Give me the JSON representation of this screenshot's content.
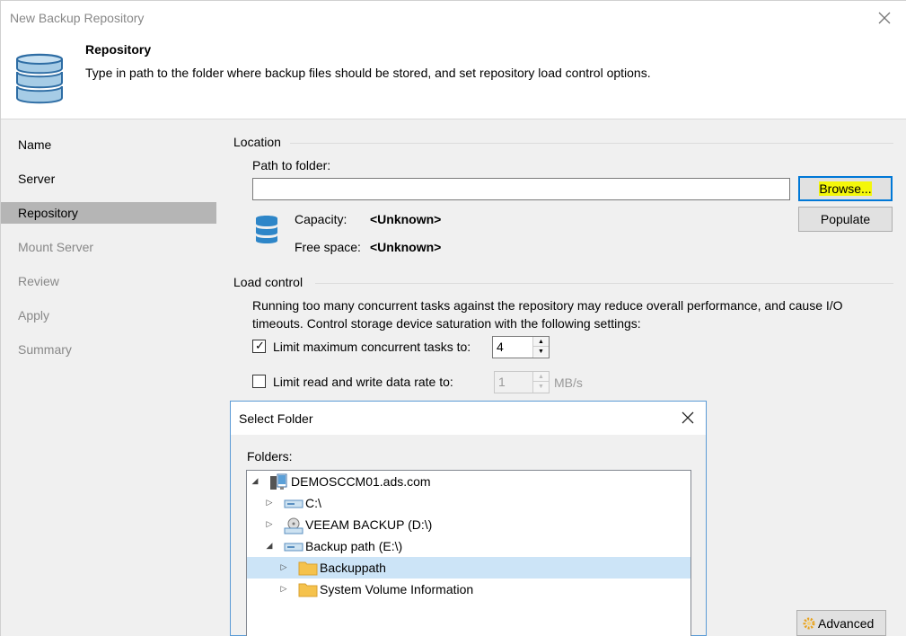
{
  "window": {
    "title": "New Backup Repository"
  },
  "header": {
    "title": "Repository",
    "description": "Type in path to the folder where backup files should be stored, and set repository load control options."
  },
  "sidebar": {
    "items": [
      {
        "label": "Name",
        "state": "normal"
      },
      {
        "label": "Server",
        "state": "normal"
      },
      {
        "label": "Repository",
        "state": "active"
      },
      {
        "label": "Mount Server",
        "state": "dim"
      },
      {
        "label": "Review",
        "state": "dim"
      },
      {
        "label": "Apply",
        "state": "dim"
      },
      {
        "label": "Summary",
        "state": "dim"
      }
    ]
  },
  "location": {
    "section_title": "Location",
    "path_label": "Path to folder:",
    "path_value": "",
    "browse_label": "Browse...",
    "populate_label": "Populate",
    "capacity_label": "Capacity:",
    "capacity_value": "<Unknown>",
    "free_space_label": "Free space:",
    "free_space_value": "<Unknown>"
  },
  "load_control": {
    "section_title": "Load control",
    "description_line1": "Running too many concurrent tasks against the repository may reduce overall performance, and cause I/O",
    "description_line2": "timeouts. Control storage device saturation with the following settings:",
    "limit_tasks_label": "Limit maximum concurrent tasks to:",
    "limit_tasks_checked": true,
    "limit_tasks_value": "4",
    "limit_rate_label": "Limit read and write data rate to:",
    "limit_rate_checked": false,
    "limit_rate_value": "1",
    "limit_rate_unit": "MB/s"
  },
  "select_folder": {
    "title": "Select Folder",
    "folders_label": "Folders:",
    "tree": [
      {
        "label": "DEMOSCCM01.ads.com",
        "level": 0,
        "expanded": true,
        "icon": "server-icon"
      },
      {
        "label": "C:\\",
        "level": 1,
        "expanded": false,
        "icon": "drive-icon"
      },
      {
        "label": "VEEAM BACKUP (D:\\)",
        "level": 1,
        "expanded": false,
        "icon": "cd-drive-icon"
      },
      {
        "label": "Backup path (E:\\)",
        "level": 1,
        "expanded": true,
        "icon": "drive-icon"
      },
      {
        "label": "Backuppath",
        "level": 2,
        "expanded": false,
        "icon": "folder-icon",
        "selected": true
      },
      {
        "label": "System Volume Information",
        "level": 2,
        "expanded": false,
        "icon": "folder-icon"
      }
    ]
  },
  "advanced": {
    "label": "Advanced"
  },
  "colors": {
    "accent": "#0078d7",
    "selection": "#cce4f7",
    "highlight": "#f4f70a",
    "db_icon": "#2e86c8",
    "folder": "#f5c24c"
  }
}
